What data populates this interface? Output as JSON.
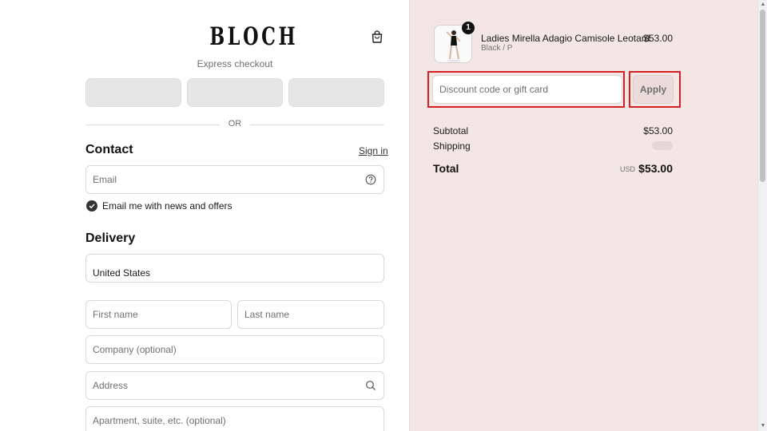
{
  "brand": {
    "logo_text": "BLOCH"
  },
  "express_checkout": {
    "label": "Express checkout",
    "or_label": "OR"
  },
  "contact": {
    "title": "Contact",
    "signin_label": "Sign in",
    "email_placeholder": "Email",
    "newsletter_label": "Email me with news and offers",
    "newsletter_checked": true
  },
  "delivery": {
    "title": "Delivery",
    "country_value": "United States",
    "first_name_placeholder": "First name",
    "last_name_placeholder": "Last name",
    "company_placeholder": "Company (optional)",
    "address_placeholder": "Address",
    "apartment_placeholder": "Apartment, suite, etc. (optional)"
  },
  "order_summary": {
    "product": {
      "name": "Ladies Mirella Adagio Camisole Leotard",
      "variant": "Black / P",
      "price": "$53.00",
      "quantity": "1"
    },
    "discount_placeholder": "Discount code or gift card",
    "apply_label": "Apply",
    "subtotal_label": "Subtotal",
    "subtotal_value": "$53.00",
    "shipping_label": "Shipping",
    "total_label": "Total",
    "total_currency": "USD",
    "total_value": "$53.00"
  },
  "icons": {
    "cart": "shopping-bag-icon",
    "help": "question-circle-icon",
    "search": "search-icon",
    "check": "check-icon"
  },
  "colors": {
    "summary_background": "#f3e6e5",
    "highlight_outline": "#d32020",
    "express_button": "#e6e6e6"
  }
}
